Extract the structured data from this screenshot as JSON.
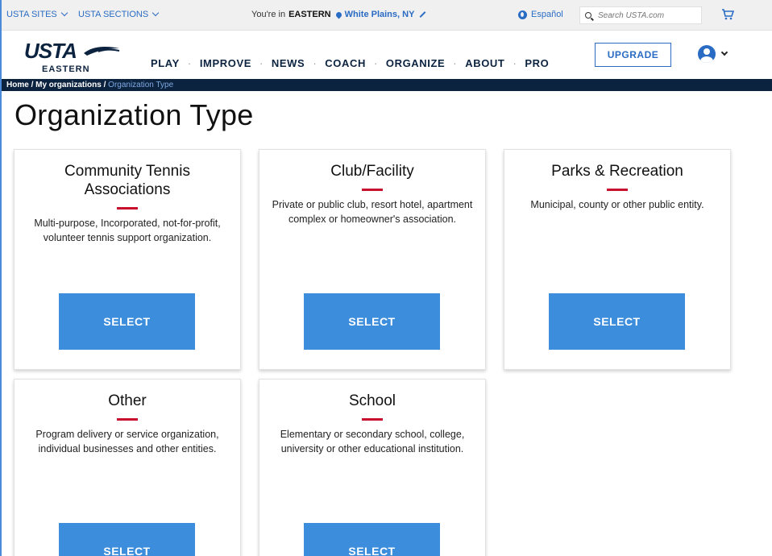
{
  "utility": {
    "sites_label": "USTA SITES",
    "sections_label": "USTA SECTIONS",
    "location_prefix": "You're in",
    "location_section": "EASTERN",
    "location_city": "White Plains, NY",
    "language": "Español",
    "search_placeholder": "Search USTA.com"
  },
  "header": {
    "logo_text": "USTA",
    "logo_sub": "EASTERN",
    "nav": [
      "PLAY",
      "IMPROVE",
      "NEWS",
      "COACH",
      "ORGANIZE",
      "ABOUT",
      "PRO"
    ],
    "nav_separator": "·",
    "upgrade_label": "UPGRADE"
  },
  "breadcrumb": {
    "items": [
      "Home",
      "My organizations"
    ],
    "separator": "/",
    "current": "Organization Type"
  },
  "page_title": "Organization Type",
  "cards": [
    {
      "title": "Community Tennis Associations",
      "description": "Multi-purpose, Incorporated, not-for-profit, volunteer tennis support organization.",
      "button": "SELECT"
    },
    {
      "title": "Club/Facility",
      "description": "Private or public club, resort hotel, apartment complex or homeowner's association.",
      "button": "SELECT"
    },
    {
      "title": "Parks & Recreation",
      "description": "Municipal, county or other public entity.",
      "button": "SELECT"
    },
    {
      "title": "Other",
      "description": "Program delivery or service organization, individual businesses and other entities.",
      "button": "SELECT"
    },
    {
      "title": "School",
      "description": "Elementary or secondary school, college, university or other educational institution.",
      "button": "SELECT"
    }
  ],
  "colors": {
    "brand_navy": "#0c2340",
    "link_blue": "#2a6cc4",
    "button_blue": "#3c8ddb",
    "accent_red": "#c8102e"
  },
  "icons": [
    "chevron-down-icon",
    "pin-icon",
    "pencil-icon",
    "globe-icon",
    "search-icon",
    "cart-icon",
    "avatar-icon"
  ]
}
